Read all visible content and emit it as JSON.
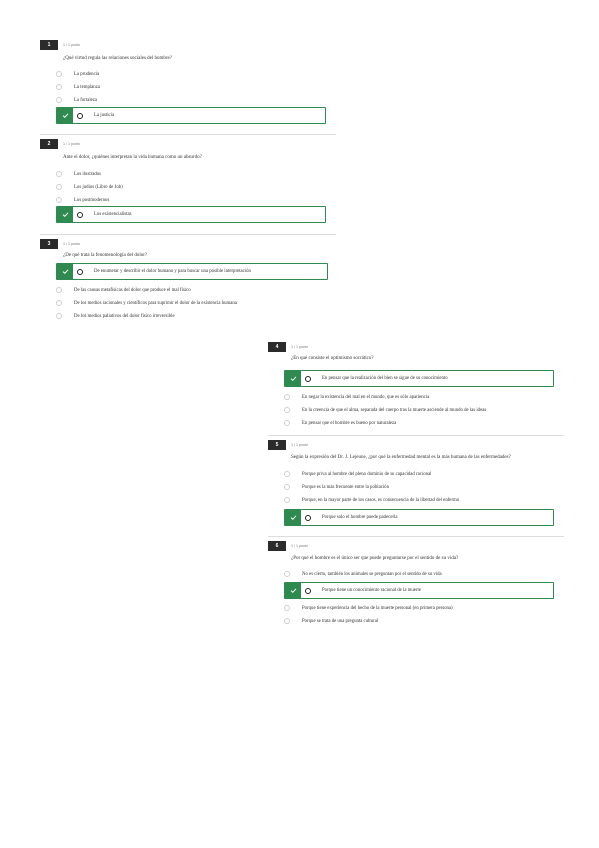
{
  "panel_a": {
    "questions": [
      {
        "number": "1",
        "points": "1 / 1 punto",
        "text": "¿Qué virtud regula las relaciones sociales del hombre?",
        "options": [
          "La prudencia",
          "La templanza",
          "La fortaleza"
        ],
        "selected": "La justicia"
      },
      {
        "number": "2",
        "points": "1 / 1 punto",
        "text": "Ante el dolor, ¿quiénes interpretan la vida humana como un absurdo?",
        "options": [
          "Los ilustrados",
          "Los judíos (Libro de Job)",
          "Los postmodernos"
        ],
        "selected": "Los existencialistas"
      },
      {
        "number": "3",
        "points": "1 / 1 punto",
        "text": "¿De qué trata la fenomenología del dolor?",
        "selected": "De enumerar y describir el dolor humano y para buscar una posible interpretación",
        "options": [
          "De las causas metafísicas del dolor que produce el mal físico",
          "De los medios racionales y científicos para suprimir el dolor de la existencia humana",
          "De los medios paliativos del dolor físico irreversible"
        ]
      }
    ]
  },
  "panel_b": {
    "questions": [
      {
        "number": "4",
        "points": "1 / 1 punto",
        "text": "¿En qué consiste el optimismo socrático?",
        "selected": "En pensar que la realización del bien se sigue de su conocimiento",
        "options": [
          "En negar la existencia del mal en el mundo, que es sólo apariencia",
          "En la creencia de que el alma, separada del cuerpo tras la muerte asciende al mundo de las ideas",
          "En pensar que el hombre es bueno por naturaleza"
        ]
      },
      {
        "number": "5",
        "points": "1 / 1 punto",
        "text": "Según la expresión del Dr. J. Lejeune, ¿por qué la enfermedad mental es la más humana de las enfermedades?",
        "options": [
          "Porque priva al hombre del pleno dominio de su capacidad racional",
          "Porque es la más frecuente entre la población",
          "Porque, en la mayor parte de los casos, es consecuencia de la libertad del enfermo"
        ],
        "selected": "Porque solo el hombre puede padecerla"
      },
      {
        "number": "6",
        "points": "1 / 1 punto",
        "text": "¿Por qué el hombre es el único ser que puede preguntarse por el sentido de su vida?",
        "options_before": [
          "No es cierto, también los animales se preguntan por el sentido de su vida"
        ],
        "selected": "Porque tiene un conocimiento racional de la muerte",
        "options": [
          "Porque tiene experiencia del hecho de la muerte personal (en primera persona)",
          "Porque se trata de una pregunta cultural"
        ]
      }
    ]
  },
  "colors": {
    "correct": "#2f8a4f",
    "number_badge": "#2b2b2b"
  },
  "icons": {
    "correct_marker": "check-icon"
  }
}
